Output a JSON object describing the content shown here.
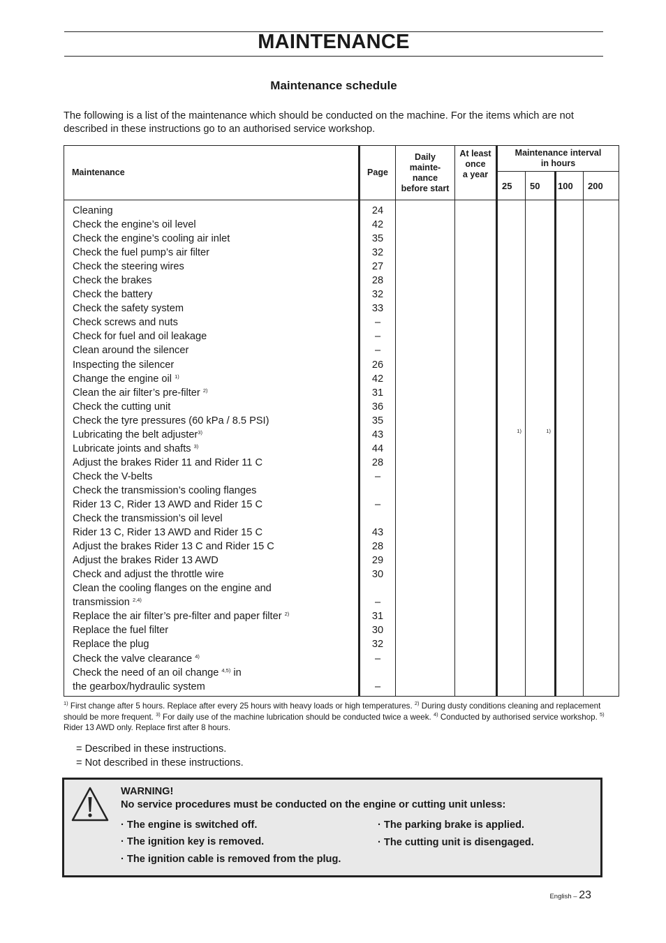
{
  "header": {
    "title": "MAINTENANCE",
    "subtitle": "Maintenance schedule",
    "intro": "The following is a list of the maintenance which should be conducted on the machine. For the items which are not described in these instructions go to an authorised service workshop."
  },
  "table": {
    "headers": {
      "maintenance": "Maintenance",
      "page": "Page",
      "daily": [
        "Daily",
        "mainte-",
        "nance",
        "before start"
      ],
      "year": [
        "At least",
        "once",
        "a year"
      ],
      "interval": [
        "Maintenance interval",
        "in hours"
      ],
      "hours": [
        "25",
        "50",
        "100",
        "200"
      ]
    },
    "rows": [
      {
        "text": "Cleaning",
        "sup": "",
        "page": "24"
      },
      {
        "text": "Check the engine’s oil level",
        "sup": "",
        "page": "42"
      },
      {
        "text": "Check the engine’s cooling air inlet",
        "sup": "",
        "page": "35"
      },
      {
        "text": "Check the fuel pump’s air filter",
        "sup": "",
        "page": "32"
      },
      {
        "text": "Check the steering wires",
        "sup": "",
        "page": "27"
      },
      {
        "text": "Check the brakes",
        "sup": "",
        "page": "28"
      },
      {
        "text": "Check the battery",
        "sup": "",
        "page": "32"
      },
      {
        "text": "Check the safety system",
        "sup": "",
        "page": "33"
      },
      {
        "text": "Check screws and nuts",
        "sup": "",
        "page": "–"
      },
      {
        "text": "Check for fuel and oil leakage",
        "sup": "",
        "page": "–"
      },
      {
        "text": "Clean around the silencer",
        "sup": "",
        "page": "–"
      },
      {
        "text": "Inspecting the silencer",
        "sup": "",
        "page": "26"
      },
      {
        "text": "Change the engine oil ",
        "sup": "1)",
        "page": "42"
      },
      {
        "text": "Clean the air filter’s pre-filter ",
        "sup": "2)",
        "page": "31"
      },
      {
        "text": "Check the cutting unit",
        "sup": "",
        "page": "36"
      },
      {
        "text": "Check the tyre pressures (60 kPa / 8.5 PSI)",
        "sup": "",
        "page": "35"
      },
      {
        "text": "Lubricating the belt adjuster",
        "sup": "3)",
        "page": "43"
      },
      {
        "text": "Lubricate joints and shafts ",
        "sup": "3)",
        "page": "44"
      },
      {
        "text": "Adjust the brakes  Rider 11 and Rider 11 C",
        "sup": "",
        "page": "28"
      },
      {
        "text": "Check the V-belts",
        "sup": "",
        "page": "–"
      },
      {
        "text": "Check the transmission’s cooling flanges",
        "sup": "",
        "page": ""
      },
      {
        "text": "Rider 13 C, Rider 13 AWD and Rider 15 C",
        "sup": "",
        "page": "–"
      },
      {
        "text": "Check the transmission’s oil level",
        "sup": "",
        "page": ""
      },
      {
        "text": "Rider 13 C, Rider 13 AWD and Rider 15 C",
        "sup": "",
        "page": "43"
      },
      {
        "text": "Adjust the brakes Rider 13 C and Rider 15 C",
        "sup": "",
        "page": "28"
      },
      {
        "text": "Adjust the brakes Rider 13 AWD",
        "sup": "",
        "page": "29"
      },
      {
        "text": "Check and adjust the throttle wire",
        "sup": "",
        "page": "30"
      },
      {
        "text": "Clean the cooling flanges on the engine and",
        "sup": "",
        "page": ""
      },
      {
        "text": "transmission ",
        "sup": "2,4)",
        "page": "–"
      },
      {
        "text": "Replace the air filter’s pre-filter and paper filter ",
        "sup": "2)",
        "page": "31"
      },
      {
        "text": "Replace the fuel filter",
        "sup": "",
        "page": "30"
      },
      {
        "text": "Replace the plug",
        "sup": "",
        "page": "32"
      },
      {
        "text": "Check the valve clearance ",
        "sup": "4)",
        "page": "–"
      },
      {
        "text": "Check the need of an oil change ",
        "sup": "4,5)",
        "suffix": " in",
        "page": ""
      },
      {
        "text": "the gearbox/hydraulic system",
        "sup": "",
        "page": "–"
      }
    ],
    "interval_marks": {
      "h25": "1)",
      "h50": "1)"
    }
  },
  "footnotes": {
    "n1_mark": "1)",
    "n1": " First change after 5 hours. Replace after every 25 hours with heavy loads or high temperatures. ",
    "n2_mark": "2)",
    "n2": " During dusty conditions cleaning and replacement should be more frequent. ",
    "n3_mark": "3)",
    "n3": " For daily use of the machine lubrication should be conducted twice a week. ",
    "n4_mark": "4)",
    "n4": " Conducted by authorised service workshop. ",
    "n5_mark": "5)",
    "n5": " Rider 13 AWD only. Replace first after 8 hours."
  },
  "legend": {
    "described": "= Described in these instructions.",
    "not_described": "= Not described in these instructions."
  },
  "warning": {
    "icon": "warning-triangle-icon",
    "heading": "WARNING!",
    "lead": "No service procedures must be conducted on the engine or cutting unit unless:",
    "items": [
      "· The engine is switched off.",
      "· The ignition key is removed.",
      "· The ignition cable is removed from the plug.",
      "· The parking brake is applied.",
      "· The cutting unit is disengaged."
    ]
  },
  "page_footer": {
    "language": "English – ",
    "page_number": "23"
  }
}
